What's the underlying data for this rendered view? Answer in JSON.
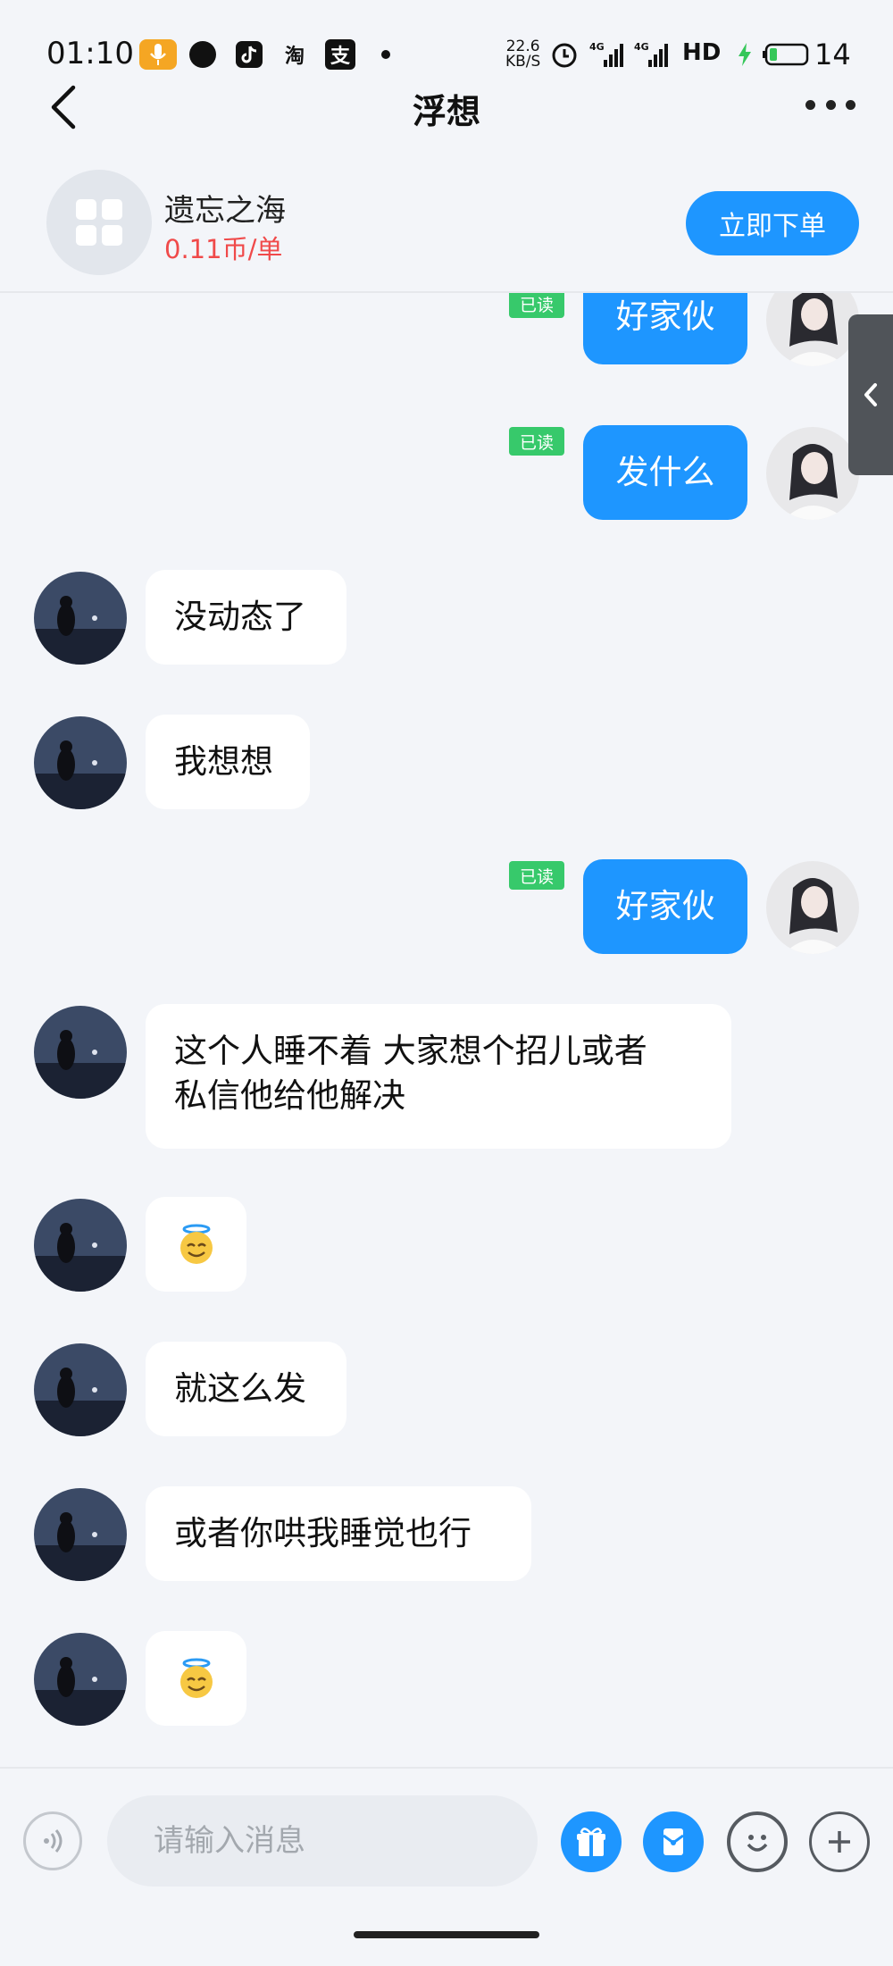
{
  "status_bar": {
    "time": "01:10",
    "speed_value": "22.6",
    "speed_unit": "KB/S",
    "network_1": "4G",
    "network_2": "4G",
    "hd_label": "HD",
    "battery_level": "14",
    "app_icons": [
      "mic-icon",
      "bubble-app-icon",
      "tiktok-icon",
      "taobao-icon",
      "alipay-icon",
      "dot-icon"
    ],
    "taobao_glyph": "淘",
    "alipay_glyph": "支"
  },
  "header": {
    "title": "浮想"
  },
  "service": {
    "name": "遗忘之海",
    "price": "0.11币/单",
    "order_button": "立即下单"
  },
  "messages": [
    {
      "side": "out",
      "text": "好家伙",
      "read_label": "已读"
    },
    {
      "side": "out",
      "text": "发什么",
      "read_label": "已读"
    },
    {
      "side": "in",
      "text": "没动态了"
    },
    {
      "side": "in",
      "text": "我想想"
    },
    {
      "side": "out",
      "text": "好家伙",
      "read_label": "已读"
    },
    {
      "side": "in",
      "text_line1": "这个人睡不着 大家想个招儿或者",
      "text_line2": "私信他给他解决"
    },
    {
      "side": "in",
      "emoji": "smiling-face-with-halo"
    },
    {
      "side": "in",
      "text": "就这么发"
    },
    {
      "side": "in",
      "text": "或者你哄我睡觉也行"
    },
    {
      "side": "in",
      "emoji": "smiling-face-with-halo"
    }
  ],
  "input_bar": {
    "placeholder": "请输入消息"
  },
  "colors": {
    "accent": "#1e96ff",
    "read_badge": "#37c96b",
    "price": "#f04a4a",
    "background": "#f3f5f9"
  }
}
